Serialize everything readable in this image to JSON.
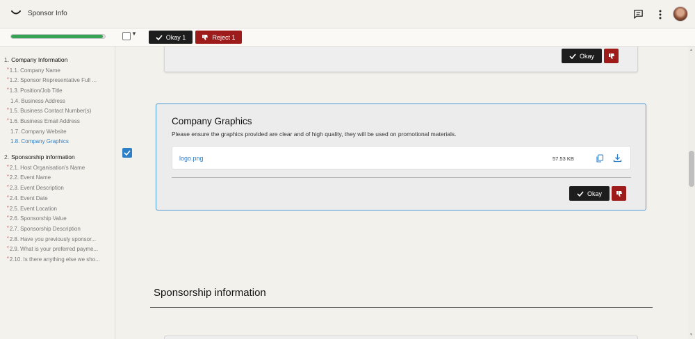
{
  "header": {
    "title": "Sponsor Info",
    "icons": [
      "logo-icon",
      "message-icon",
      "more-vertical-icon",
      "avatar"
    ]
  },
  "toolbar": {
    "progress": 0.98,
    "okay_label": "Okay 1",
    "reject_label": "Reject 1"
  },
  "sidebar": {
    "sections": [
      {
        "number": "1.",
        "title": "Company Information",
        "items": [
          {
            "number": "1.1.",
            "label": "Company Name",
            "required": true
          },
          {
            "number": "1.2.",
            "label": "Sponsor Representative Full ...",
            "required": true
          },
          {
            "number": "1.3.",
            "label": "Position/Job Title",
            "required": true
          },
          {
            "number": "1.4.",
            "label": "Business Address",
            "required": false
          },
          {
            "number": "1.5.",
            "label": "Business Contact Number(s)",
            "required": true
          },
          {
            "number": "1.6.",
            "label": "Business Email Address",
            "required": true
          },
          {
            "number": "1.7.",
            "label": "Company Website",
            "required": false
          },
          {
            "number": "1.8.",
            "label": "Company Graphics",
            "required": false
          }
        ]
      },
      {
        "number": "2.",
        "title": "Sponsorship information",
        "items": [
          {
            "number": "2.1.",
            "label": "Host Organisation's Name",
            "required": true
          },
          {
            "number": "2.2.",
            "label": "Event Name",
            "required": true
          },
          {
            "number": "2.3.",
            "label": "Event Description",
            "required": true
          },
          {
            "number": "2.4.",
            "label": "Event Date",
            "required": true
          },
          {
            "number": "2.5.",
            "label": "Event Location",
            "required": true
          },
          {
            "number": "2.6.",
            "label": "Sponsorship Value",
            "required": true
          },
          {
            "number": "2.7.",
            "label": "Sponsorship Description",
            "required": true
          },
          {
            "number": "2.8.",
            "label": "Have you previously sponsor...",
            "required": true
          },
          {
            "number": "2.9.",
            "label": "What is your preferred payme...",
            "required": true
          },
          {
            "number": "2.10.",
            "label": "Is there anything else we sho...",
            "required": true
          }
        ]
      }
    ]
  },
  "main": {
    "prev_okay_label": "Okay",
    "card": {
      "title": "Company Graphics",
      "description": "Please ensure the graphics provided are clear and of high quality, they will be used on promotional materials.",
      "file_name": "logo.png",
      "file_size": "57.53 KB",
      "okay_label": "Okay"
    },
    "section_title": "Sponsorship information"
  },
  "colors": {
    "accent": "#2d7fc7",
    "okay": "#1d1d1d",
    "reject": "#9e1b1b",
    "progress": "#37a354"
  }
}
